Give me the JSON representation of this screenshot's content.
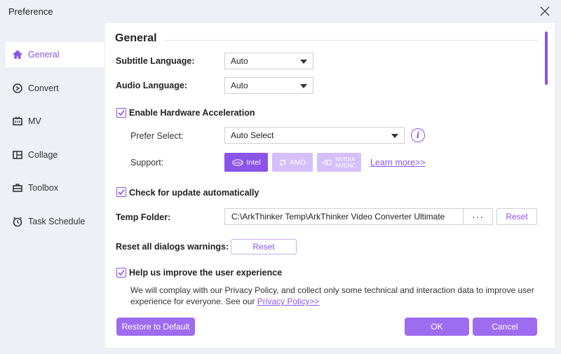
{
  "window": {
    "title": "Preference"
  },
  "sidebar": {
    "items": [
      {
        "label": "General",
        "icon": "home-icon",
        "active": true
      },
      {
        "label": "Convert",
        "icon": "convert-icon",
        "active": false
      },
      {
        "label": "MV",
        "icon": "mv-icon",
        "active": false
      },
      {
        "label": "Collage",
        "icon": "collage-icon",
        "active": false
      },
      {
        "label": "Toolbox",
        "icon": "toolbox-icon",
        "active": false
      },
      {
        "label": "Task Schedule",
        "icon": "clock-icon",
        "active": false
      }
    ]
  },
  "general": {
    "heading": "General",
    "subtitle_language": {
      "label": "Subtitle Language:",
      "value": "Auto"
    },
    "audio_language": {
      "label": "Audio Language:",
      "value": "Auto"
    },
    "hardware_acceleration": {
      "label": "Enable Hardware Acceleration",
      "checked": true,
      "prefer_select": {
        "label": "Prefer Select:",
        "value": "Auto Select"
      },
      "support": {
        "label": "Support:",
        "intel": "Intel",
        "amd": "AMD",
        "nvidia_line1": "NVIDIA",
        "nvidia_line2": "NVENC",
        "learn_more": "Learn more>>"
      }
    },
    "check_update": {
      "label": "Check for update automatically",
      "checked": true
    },
    "temp_folder": {
      "label": "Temp Folder:",
      "value": "C:\\ArkThinker Temp\\ArkThinker Video Converter Ultimate",
      "browse_label": "···",
      "reset_label": "Reset"
    },
    "reset_dialogs": {
      "label": "Reset all dialogs warnings:",
      "button": "Reset"
    },
    "improve": {
      "label": "Help us improve the user experience",
      "checked": true,
      "description": "We will complay with our Privacy Policy, and collect only some technical and interaction data to improve user experience for everyone. See our ",
      "privacy_link": "Privacy Policy>>"
    }
  },
  "footer": {
    "restore_default": "Restore to Default",
    "ok": "OK",
    "cancel": "Cancel"
  },
  "colors": {
    "accent": "#8a54e9",
    "accent_light": "#d4bffa",
    "button": "#9e6cf0",
    "sidebar_bg": "#eef0f6"
  }
}
